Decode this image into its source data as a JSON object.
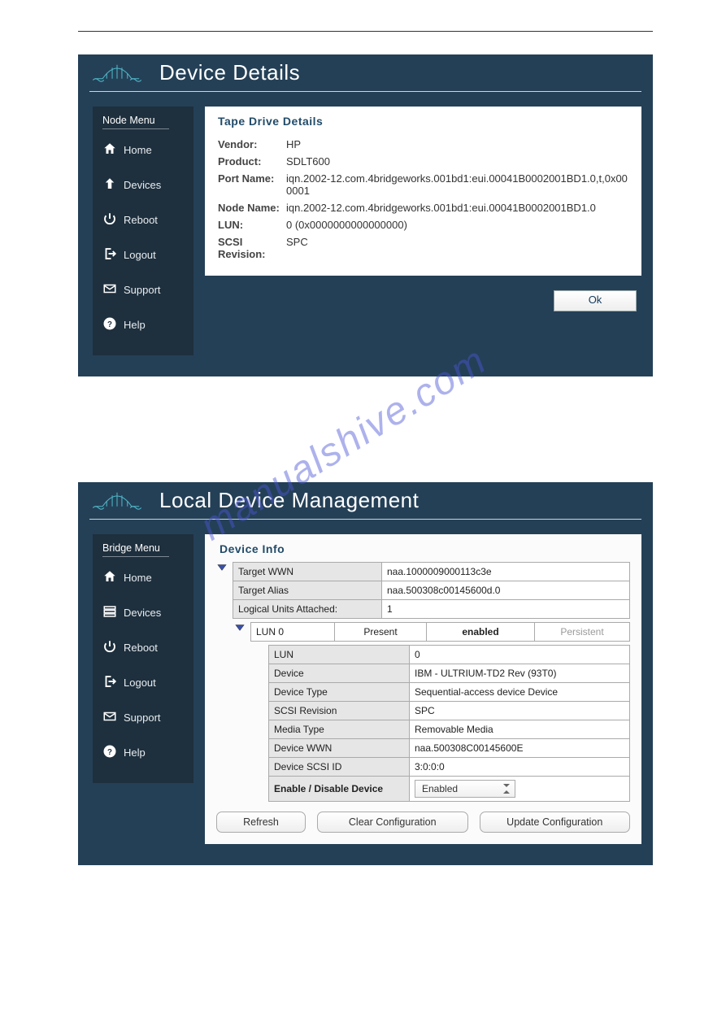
{
  "panel1": {
    "title": "Device Details",
    "sidebar_title": "Node Menu",
    "menu": {
      "home": "Home",
      "devices": "Devices",
      "reboot": "Reboot",
      "logout": "Logout",
      "support": "Support",
      "help": "Help"
    },
    "card_title": "Tape Drive Details",
    "fields": {
      "vendor_k": "Vendor:",
      "vendor_v": "HP",
      "product_k": "Product:",
      "product_v": "SDLT600",
      "port_k": "Port Name:",
      "port_v": "iqn.2002-12.com.4bridgeworks.001bd1:eui.00041B0002001BD1.0,t,0x000001",
      "node_k": "Node Name:",
      "node_v": "iqn.2002-12.com.4bridgeworks.001bd1:eui.00041B0002001BD1.0",
      "lun_k": "LUN:",
      "lun_v": "0 (0x0000000000000000)",
      "rev_k": "SCSI Revision:",
      "rev_v": "SPC"
    },
    "ok": "Ok"
  },
  "panel2": {
    "title": "Local Device Management",
    "sidebar_title": "Bridge Menu",
    "menu": {
      "home": "Home",
      "devices": "Devices",
      "reboot": "Reboot",
      "logout": "Logout",
      "support": "Support",
      "help": "Help"
    },
    "card_title": "Device Info",
    "top": {
      "twwn_k": "Target WWN",
      "twwn_v": "naa.1000009000113c3e",
      "alias_k": "Target Alias",
      "alias_v": "naa.500308c00145600d.0",
      "lua_k": "Logical Units Attached:",
      "lua_v": "1"
    },
    "lun_hdr": {
      "a": "LUN 0",
      "b": "Present",
      "c": "enabled",
      "d": "Persistent"
    },
    "lun": {
      "lun_k": "LUN",
      "lun_v": "0",
      "dev_k": "Device",
      "dev_v": "IBM - ULTRIUM-TD2 Rev (93T0)",
      "dt_k": "Device Type",
      "dt_v": "Sequential-access device Device",
      "sr_k": "SCSI Revision",
      "sr_v": "SPC",
      "mt_k": "Media Type",
      "mt_v": "Removable Media",
      "dw_k": "Device WWN",
      "dw_v": "naa.500308C00145600E",
      "ds_k": "Device SCSI ID",
      "ds_v": "3:0:0:0",
      "ed_k": "Enable / Disable Device",
      "ed_v": "Enabled"
    },
    "buttons": {
      "refresh": "Refresh",
      "clear": "Clear Configuration",
      "update": "Update Configuration"
    }
  },
  "watermark": "manualshive.com"
}
